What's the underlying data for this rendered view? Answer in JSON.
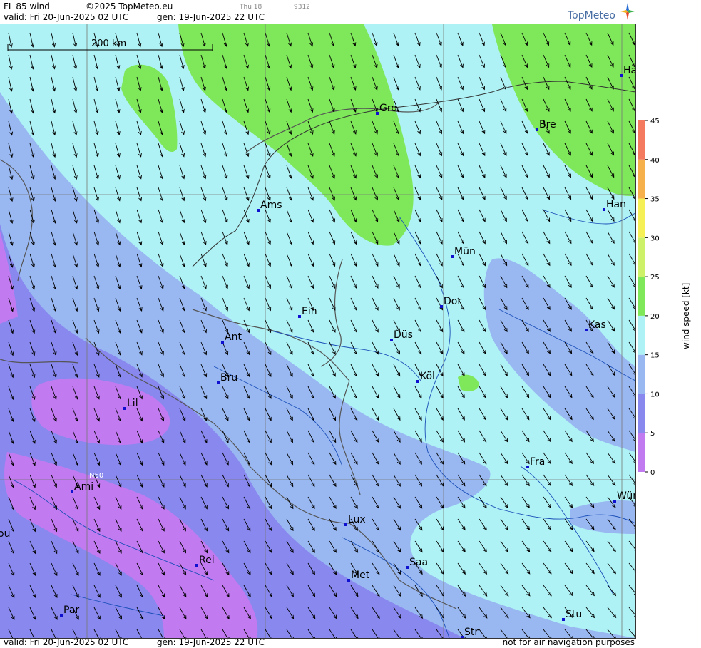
{
  "header": {
    "product": "FL 85 wind",
    "copyright": "©2025 TopMeteo.eu",
    "valid": "valid:  Fri  20-Jun-2025  02 UTC",
    "gen": "gen: 19-Jun-2025 22 UTC",
    "day_small": "Thu 18",
    "code_small": "9312"
  },
  "logo": {
    "text": "TopMeteo"
  },
  "footer": {
    "valid": "valid:  Fri  20-Jun-2025  02 UTC",
    "gen": "gen: 19-Jun-2025 22 UTC",
    "disclaimer": "not for air navigation purposes"
  },
  "map": {
    "scale_label": "200 km",
    "grid_label": "N50",
    "cities": [
      {
        "name": "Gro"
      },
      {
        "name": "Bre"
      },
      {
        "name": "Ha"
      },
      {
        "name": "Ams"
      },
      {
        "name": "Han"
      },
      {
        "name": "Mün"
      },
      {
        "name": "Ein"
      },
      {
        "name": "Dor"
      },
      {
        "name": "Kas"
      },
      {
        "name": "Ant"
      },
      {
        "name": "Düs"
      },
      {
        "name": "Köl"
      },
      {
        "name": "Bru"
      },
      {
        "name": "Lil"
      },
      {
        "name": "Fra"
      },
      {
        "name": "Ami"
      },
      {
        "name": "Wür"
      },
      {
        "name": "Lux"
      },
      {
        "name": "ou"
      },
      {
        "name": "Rei"
      },
      {
        "name": "Saa"
      },
      {
        "name": "Met"
      },
      {
        "name": "Stu"
      },
      {
        "name": "Par"
      },
      {
        "name": "Str"
      }
    ]
  },
  "legend": {
    "title": "wind  speed  [kt]",
    "ticks": [
      "45",
      "40",
      "35",
      "30",
      "25",
      "20",
      "15",
      "10",
      "5",
      "0"
    ],
    "bands": [
      {
        "from": 0,
        "to": 5,
        "color": "#c27af0"
      },
      {
        "from": 5,
        "to": 10,
        "color": "#8888ee"
      },
      {
        "from": 10,
        "to": 15,
        "color": "#99b8f2"
      },
      {
        "from": 15,
        "to": 20,
        "color": "#aef2f5"
      },
      {
        "from": 20,
        "to": 25,
        "color": "#7fe85a"
      },
      {
        "from": 25,
        "to": 30,
        "color": "#cdf26a"
      },
      {
        "from": 30,
        "to": 35,
        "color": "#f5f055"
      },
      {
        "from": 35,
        "to": 40,
        "color": "#f6b04c"
      },
      {
        "from": 40,
        "to": 45,
        "color": "#f47a60"
      }
    ]
  }
}
